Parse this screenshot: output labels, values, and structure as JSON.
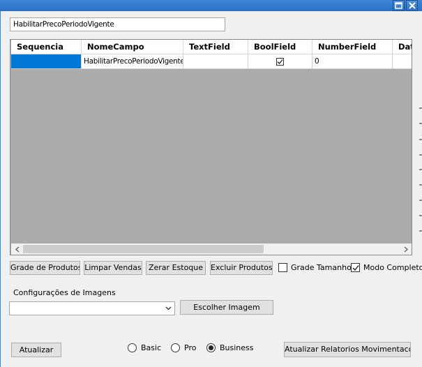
{
  "name_field": {
    "value": "HabilitarPrecoPeriodoVigente"
  },
  "grid": {
    "columns": [
      "Sequencia",
      "NomeCampo",
      "TextField",
      "BoolField",
      "NumberField",
      "Dat"
    ],
    "rows": [
      {
        "sequencia": "",
        "nome_campo": "HabilitarPrecoPeriodoVigente",
        "text_field": "",
        "bool_field": true,
        "number_field": "0"
      }
    ]
  },
  "actions": {
    "grade_produtos": "Grade de Produtos",
    "limpar_vendas": "Limpar Vendas",
    "zerar_estoque": "Zerar Estoque",
    "excluir_produtos": "Excluir Produtos"
  },
  "options": {
    "grade_tamanho": {
      "label": "Grade Tamanho",
      "checked": false
    },
    "modo_completo": {
      "label": "Modo Completo",
      "checked": true
    }
  },
  "images": {
    "label": "Configurações de Imagens",
    "selected": "",
    "choose_button": "Escolher Imagem"
  },
  "footer": {
    "update_button": "Atualizar",
    "editions": [
      {
        "label": "Basic",
        "selected": false
      },
      {
        "label": "Pro",
        "selected": false
      },
      {
        "label": "Business",
        "selected": true
      }
    ],
    "update_reports_button": "Atualizar Relatorios Movimentacoes"
  },
  "colors": {
    "selection": "#0078d7",
    "titlebar": "#2a6fc4"
  },
  "icons": {
    "restore": "restore-icon",
    "close": "close-icon"
  }
}
